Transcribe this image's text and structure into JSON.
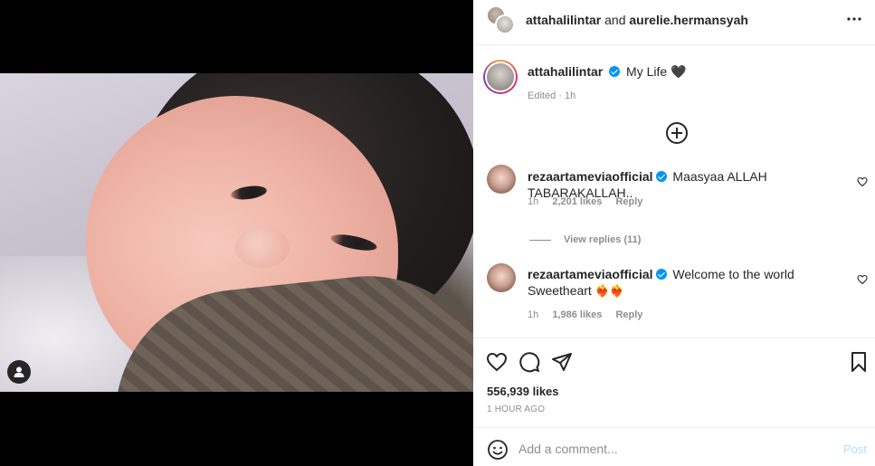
{
  "header": {
    "user1": "attahalilintar",
    "joiner": "and",
    "user2": "aurelie.hermansyah",
    "more_icon": "more-horizontal-icon"
  },
  "caption": {
    "username": "attahalilintar",
    "text": "My Life",
    "emoji": "🖤",
    "meta": "Edited · 1h"
  },
  "comments": [
    {
      "username": "rezaartameviaofficial",
      "text": "Maasyaa ALLAH TABARAKALLAH..",
      "emojis": "",
      "time": "1h",
      "likes": "2,201 likes",
      "reply": "Reply"
    },
    {
      "username": "rezaartameviaofficial",
      "text": "Welcome to the world Sweetheart",
      "emojis": "❤️‍🔥❤️‍🔥",
      "time": "1h",
      "likes": "1,986 likes",
      "reply": "Reply"
    }
  ],
  "view_replies": "View replies (11)",
  "likes": "556,939 likes",
  "posted_ago": "1 HOUR AGO",
  "add_comment": {
    "placeholder": "Add a comment...",
    "post_label": "Post"
  },
  "colors": {
    "verified": "#0095f6",
    "post_disabled": "#b2dffc",
    "muted": "#8e8e8e"
  }
}
